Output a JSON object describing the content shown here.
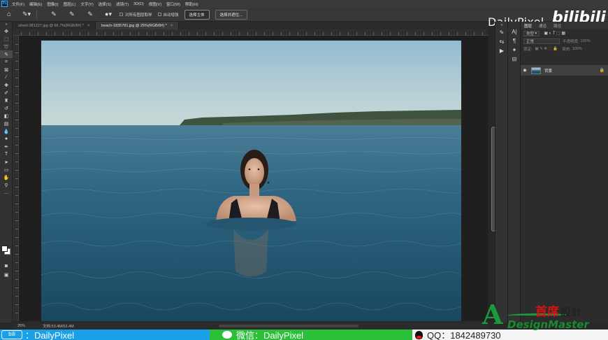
{
  "app": {
    "logo": "Ps",
    "menu": [
      "文件(F)",
      "编辑(E)",
      "图像(I)",
      "图层(L)",
      "文字(Y)",
      "选择(S)",
      "滤镜(T)",
      "3D(D)",
      "视图(V)",
      "窗口(W)",
      "帮助(H)"
    ]
  },
  "options": {
    "sample_all_layers": "对所有图层取样",
    "auto_enhance": "自动增强",
    "select_subject": "选择主体",
    "select_and_mask": "选择并遮住..."
  },
  "overlay": {
    "brand": "DailyPixel",
    "bilibili": "bilibili"
  },
  "tabs": [
    {
      "label": "street-381227.jpg @ 66.7%(RGB/8#) *",
      "close": "×",
      "active": false
    },
    {
      "label": "beach-1835781.jpg @ 25%(RGB/8#) *",
      "close": "×",
      "active": true
    }
  ],
  "layers_panel": {
    "tabs": [
      "图层",
      "通道",
      "路径"
    ],
    "kind_label": "类型",
    "blend_mode": "正常",
    "opacity_label": "不透明度:",
    "opacity_value": "100%",
    "lock_label": "锁定:",
    "fill_label": "填充:",
    "fill_value": "100%",
    "layer_name": "背景"
  },
  "status": {
    "zoom": "25%",
    "doc": "文档:53.4M/53.4M"
  },
  "banner": {
    "bili_icon": "bili",
    "bili_text": "：DailyPixel",
    "wechat_text": "微信：DailyPixel",
    "qq_text": "QQ：1842489730"
  },
  "watermark": {
    "cn_main": "首席",
    "cn_trad": "設計",
    "en": "DesignMaster",
    "mark": "A"
  },
  "colors": {
    "banner_blue": "#1aa0e6",
    "banner_green": "#2bbf3a",
    "ps_accent": "#31a8ff"
  }
}
